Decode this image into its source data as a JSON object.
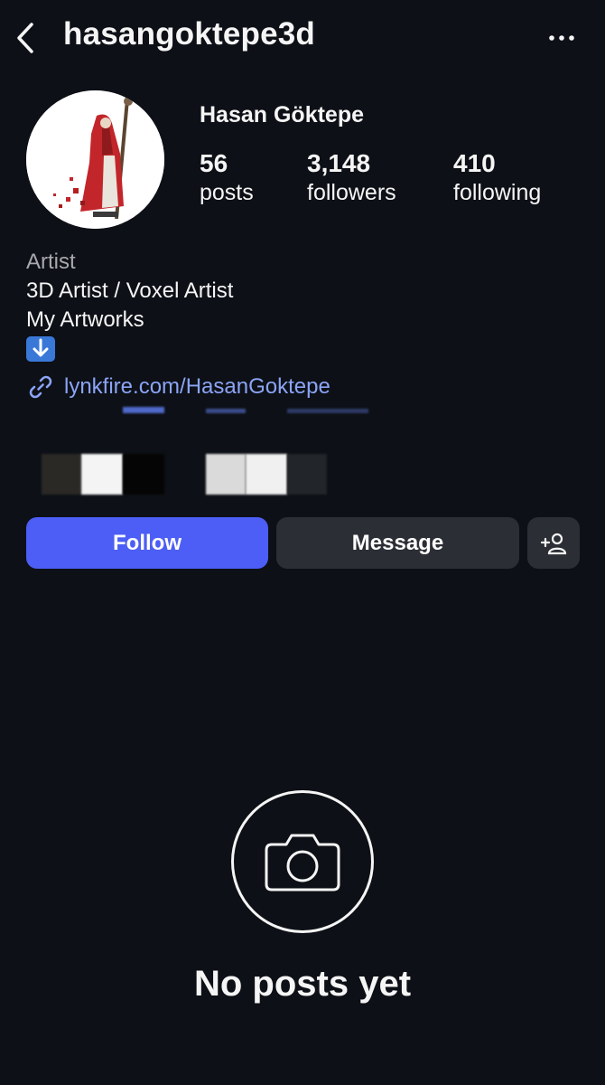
{
  "header": {
    "username": "hasangoktepe3d",
    "back_icon": "chevron-left-icon",
    "more_icon": "more-horizontal-icon"
  },
  "profile": {
    "display_name": "Hasan Göktepe",
    "stats": {
      "posts": {
        "value": "56",
        "label": "posts"
      },
      "followers": {
        "value": "3,148",
        "label": "followers"
      },
      "following": {
        "value": "410",
        "label": "following"
      }
    }
  },
  "bio": {
    "category": "Artist",
    "lines": [
      "3D Artist / Voxel Artist",
      "My Artworks"
    ],
    "emoji": "⬇️",
    "link": "lynkfire.com/HasanGoktepe"
  },
  "actions": {
    "follow_label": "Follow",
    "message_label": "Message",
    "add_user_icon": "add-person-icon"
  },
  "empty_state": {
    "text": "No posts yet",
    "icon": "camera-icon"
  },
  "colors": {
    "background": "#0d1016",
    "accent": "#4c5ef5",
    "link": "#8ba4f6",
    "button_secondary": "#2b2e34"
  }
}
